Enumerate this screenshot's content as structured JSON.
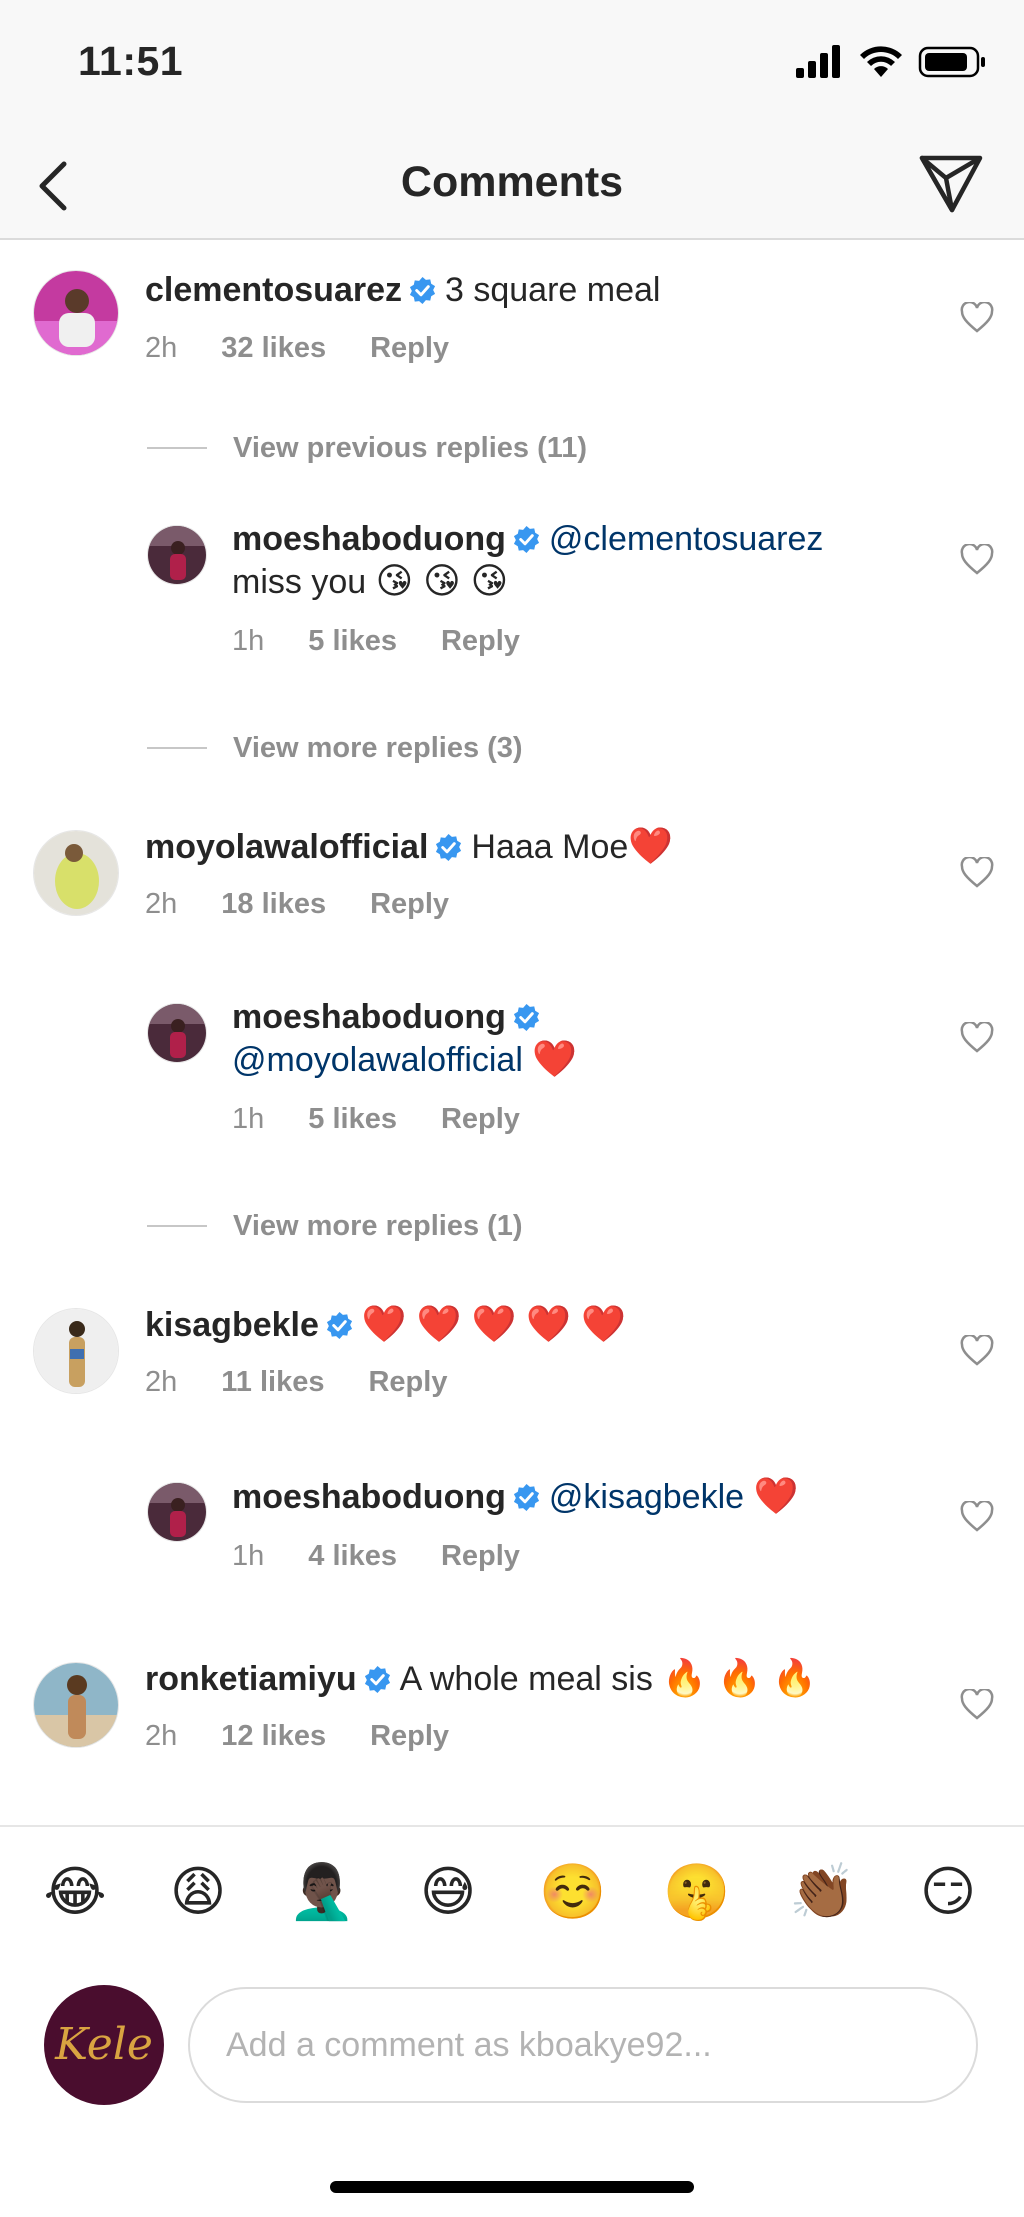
{
  "status_bar": {
    "time": "11:51"
  },
  "header": {
    "title": "Comments"
  },
  "comments": [
    {
      "user": "clementosuarez",
      "text": "3 square meal",
      "time": "2h",
      "likes": "32 likes",
      "reply_label": "Reply"
    },
    {
      "view_label": "View previous replies (11)"
    },
    {
      "user": "moeshaboduong",
      "mention": "@clementosuarez",
      "text": "miss you",
      "emoji": "😘 😘 😘",
      "time": "1h",
      "likes": "5 likes",
      "reply_label": "Reply"
    },
    {
      "view_label": "View more replies (3)"
    },
    {
      "user": "moyolawalofficial",
      "text": "Haaa Moe",
      "emoji": "❤️",
      "time": "2h",
      "likes": "18 likes",
      "reply_label": "Reply"
    },
    {
      "user": "moeshaboduong",
      "mention": "@moyolawalofficial",
      "emoji": "❤️",
      "time": "1h",
      "likes": "5 likes",
      "reply_label": "Reply"
    },
    {
      "view_label": "View more replies (1)"
    },
    {
      "user": "kisagbekle",
      "emoji": "❤️ ❤️ ❤️ ❤️ ❤️",
      "time": "2h",
      "likes": "11 likes",
      "reply_label": "Reply"
    },
    {
      "user": "moeshaboduong",
      "mention": "@kisagbekle",
      "emoji": "❤️",
      "time": "1h",
      "likes": "4 likes",
      "reply_label": "Reply"
    },
    {
      "user": "ronketiamiyu",
      "text": "A whole meal sis",
      "emoji": "🔥 🔥 🔥",
      "time": "2h",
      "likes": "12 likes",
      "reply_label": "Reply"
    }
  ],
  "emoji_bar": [
    "😂",
    "😩",
    "🤦🏿‍♂️",
    "😅",
    "☺️",
    "🤫",
    "👏🏾",
    "😏"
  ],
  "composer": {
    "avatar_text": "Kele",
    "placeholder": "Add a comment as kboakye92..."
  },
  "colors": {
    "verified": "#3897f0",
    "mention": "#003569",
    "meta": "#8e8e8e",
    "avatar_bg": "#4a0d2e"
  }
}
